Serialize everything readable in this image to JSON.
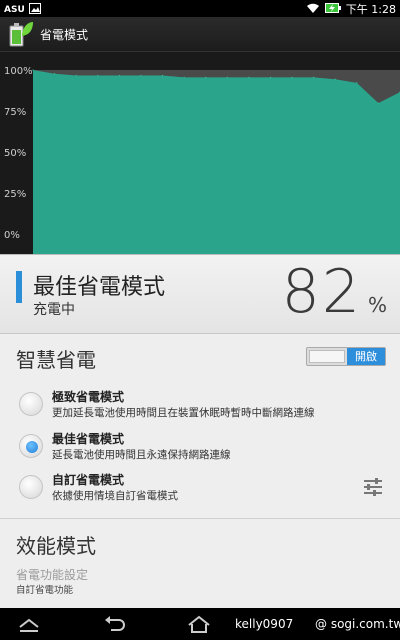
{
  "status_bar": {
    "time": "下午 1:28",
    "icons": [
      "asus-icon",
      "image-icon",
      "wifi-icon",
      "battery-charging-icon"
    ]
  },
  "app": {
    "title": "省電模式",
    "icon": "battery-leaf-icon"
  },
  "chart_data": {
    "type": "area",
    "title": "",
    "xlabel": "",
    "ylabel": "",
    "ylim": [
      0,
      100
    ],
    "y_ticks": [
      "100%",
      "75%",
      "50%",
      "25%",
      "0%"
    ],
    "series": [
      {
        "values": [
          100,
          98,
          97,
          97,
          97,
          97,
          97,
          96,
          96,
          96,
          96,
          96,
          96,
          96,
          95,
          93,
          82,
          88
        ]
      }
    ],
    "fill_color": "#2aa58c",
    "background_color": "#1a1a1a",
    "max_area_color": "#4a4a4a",
    "grid": false
  },
  "mode_panel": {
    "name": "最佳省電模式",
    "status": "充電中",
    "percent": "82",
    "percent_sign": "%",
    "accent_color": "#2a8fd8"
  },
  "smart_saving": {
    "title": "智慧省電",
    "toggle_label": "開啟",
    "toggle_on": true,
    "options": [
      {
        "title": "極致省電模式",
        "desc": "更加延長電池使用時間且在裝置休眠時暫時中斷網路連線",
        "selected": false
      },
      {
        "title": "最佳省電模式",
        "desc": "延長電池使用時間且永遠保持網路連線",
        "selected": true
      },
      {
        "title": "自訂省電模式",
        "desc": "依據使用情境自訂省電模式",
        "selected": false
      }
    ]
  },
  "performance": {
    "title": "效能模式",
    "setting_label": "省電功能設定",
    "setting_sub": "自訂省電功能"
  },
  "nav_bar": {
    "watermark_left": "kelly0907",
    "watermark_right": "@ sogi.com.tw"
  }
}
